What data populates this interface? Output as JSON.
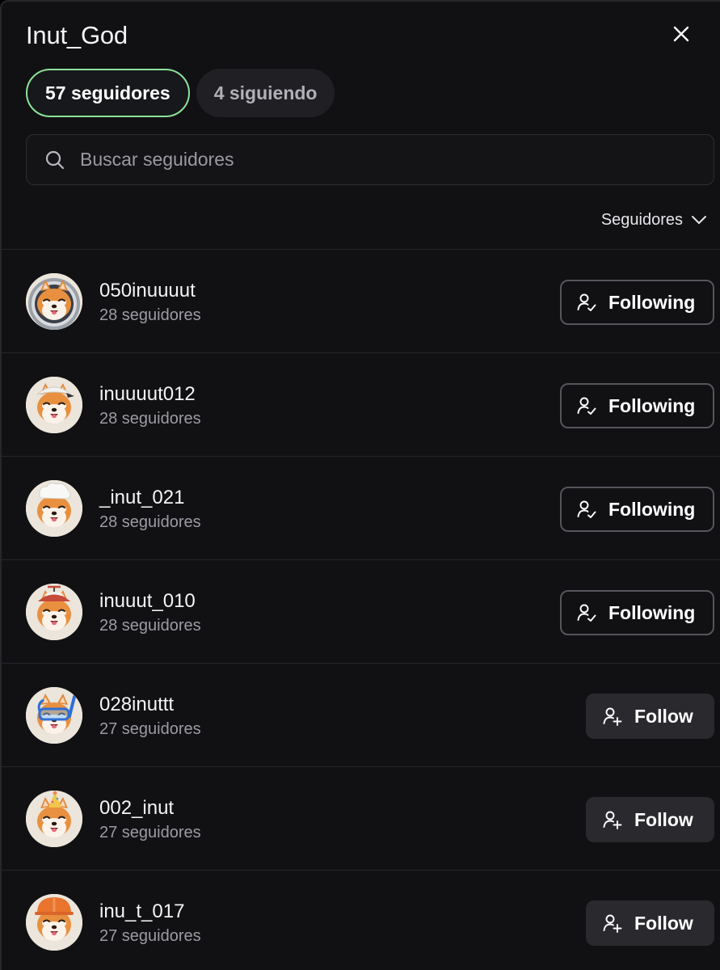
{
  "header": {
    "title": "Inut_God"
  },
  "tabs": [
    {
      "label": "57 seguidores",
      "active": true
    },
    {
      "label": "4 siguiendo",
      "active": false
    }
  ],
  "search": {
    "placeholder": "Buscar seguidores",
    "value": ""
  },
  "sort": {
    "label": "Seguidores"
  },
  "colors": {
    "accent": "#8ee29a",
    "background": "#111114",
    "button": "#2a2a2e"
  },
  "followers": [
    {
      "username": "050inuuuut",
      "count": "28 seguidores",
      "button": "Following",
      "state": "following",
      "avatar_accessory": "astronaut-helmet"
    },
    {
      "username": "inuuuut012",
      "count": "28 seguidores",
      "button": "Following",
      "state": "following",
      "avatar_accessory": "white-cap"
    },
    {
      "username": "_inut_021",
      "count": "28 seguidores",
      "button": "Following",
      "state": "following",
      "avatar_accessory": "chef-hat"
    },
    {
      "username": "inuuut_010",
      "count": "28 seguidores",
      "button": "Following",
      "state": "following",
      "avatar_accessory": "propeller-cap"
    },
    {
      "username": "028inuttt",
      "count": "27 seguidores",
      "button": "Follow",
      "state": "follow",
      "avatar_accessory": "snorkel-mask"
    },
    {
      "username": "002_inut",
      "count": "27 seguidores",
      "button": "Follow",
      "state": "follow",
      "avatar_accessory": "party-hat"
    },
    {
      "username": "inu_t_017",
      "count": "27 seguidores",
      "button": "Follow",
      "state": "follow",
      "avatar_accessory": "hard-hat"
    }
  ]
}
